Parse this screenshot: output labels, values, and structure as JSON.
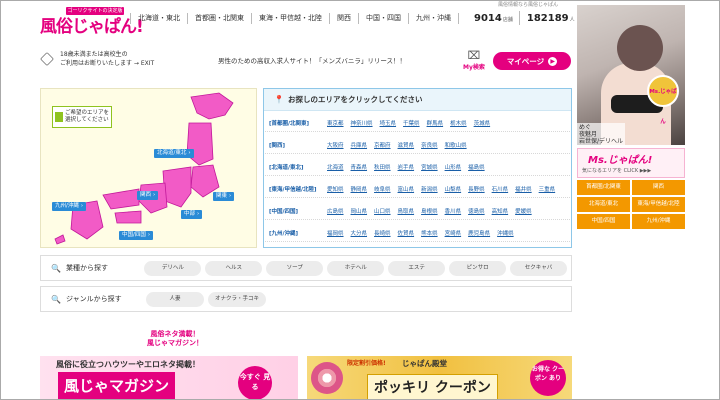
{
  "header": {
    "logo_text": "風俗じゃぱん!",
    "logo_tag": "ゴーリクサイトの決定版",
    "top_info": "風俗情報なら風俗じゃぱん",
    "regions": [
      "北海道・東北",
      "首都圏・北関東",
      "東海・甲信越・北陸",
      "関西",
      "中国・四国",
      "九州・沖縄"
    ],
    "shop_count": "9014",
    "shop_unit": "店舗",
    "girl_count": "182189",
    "girl_unit": "人"
  },
  "notice": {
    "age_line1": "18歳未満または高校生の",
    "age_line2": "ご利用はお断りいたします → EXIT",
    "announce": "男性のための高収入求人サイト！「メンズバニラ」リリース！！",
    "mysearch_icon": "⌧",
    "mysearch_label": "My検索",
    "mypage_label": "マイページ",
    "mypage_arrow": "▶"
  },
  "map": {
    "note_line1": "ご希望のエリアを",
    "note_line2": "選択してください",
    "tags": [
      "北海道/東北",
      "関東",
      "関西",
      "中部",
      "九州/沖縄",
      "中国/四国"
    ],
    "colors": {
      "land": "#f25bc6",
      "land_edge": "#c2189a",
      "tag": "#2a8bd6"
    }
  },
  "area_panel": {
    "title": "お探しのエリアをクリックしてください",
    "pin_icon": "📍",
    "rows": [
      {
        "region": "[首都圏/北関東]",
        "prefs": [
          "東京都",
          "神奈川県",
          "埼玉県",
          "千葉県",
          "群馬県",
          "栃木県",
          "茨城県"
        ]
      },
      {
        "region": "[関西]",
        "prefs": [
          "大阪府",
          "兵庫県",
          "京都府",
          "滋賀県",
          "奈良県",
          "和歌山県"
        ]
      },
      {
        "region": "[北海道/東北]",
        "prefs": [
          "北海道",
          "青森県",
          "秋田県",
          "岩手県",
          "宮城県",
          "山形県",
          "福島県"
        ]
      },
      {
        "region": "[東海/甲信越/北陸]",
        "prefs": [
          "愛知県",
          "静岡県",
          "岐阜県",
          "富山県",
          "新潟県",
          "山梨県",
          "長野県",
          "石川県",
          "福井県",
          "三重県"
        ]
      },
      {
        "region": "[中国/四国]",
        "prefs": [
          "広島県",
          "岡山県",
          "山口県",
          "鳥取県",
          "島根県",
          "香川県",
          "徳島県",
          "高知県",
          "愛媛県"
        ]
      },
      {
        "region": "[九州/沖縄]",
        "prefs": [
          "福岡県",
          "大分県",
          "長崎県",
          "佐賀県",
          "熊本県",
          "宮崎県",
          "鹿児島県",
          "沖縄県"
        ]
      }
    ]
  },
  "search": {
    "industry_label": "業種から探す",
    "industry_options": [
      "デリヘル",
      "ヘルス",
      "ソープ",
      "ホテヘル",
      "エステ",
      "ピンサロ",
      "セクキャバ"
    ],
    "genre_label": "ジャンルから探す",
    "genre_options": [
      "人妻",
      "オナクラ・手コキ"
    ],
    "search_icon": "🔍"
  },
  "magazine": {
    "title_line1": "風俗ネタ満載！",
    "title_line2": "風じゃマガジン！",
    "banner_line1": "風俗に役立つハウツーやエロネタ掲載！",
    "banner_title": "風じゃマガジン",
    "banner_go": "今すぐ 見る"
  },
  "coupon": {
    "line1": "限定割引価格!",
    "line2": "じゃぱん殿堂",
    "title": "ポッキリ クーポン",
    "badge": "お得な クーポン あり"
  },
  "sidebar": {
    "girl_name": "めぐ",
    "girl_shop": "夜魅月",
    "girl_area": "岩世保/デリヘル",
    "badge": "Ms.じゃぱん",
    "ms_title": "Ms.じゃぱん!",
    "ms_sub": "気になるエリアを CLICK ▶▶▶",
    "buttons": [
      "首都圏/北関東",
      "関西",
      "北海道/東北",
      "東海/甲信越/北陸",
      "中国/四国",
      "九州/沖縄"
    ],
    "colors": {
      "button": "#f39800"
    }
  }
}
